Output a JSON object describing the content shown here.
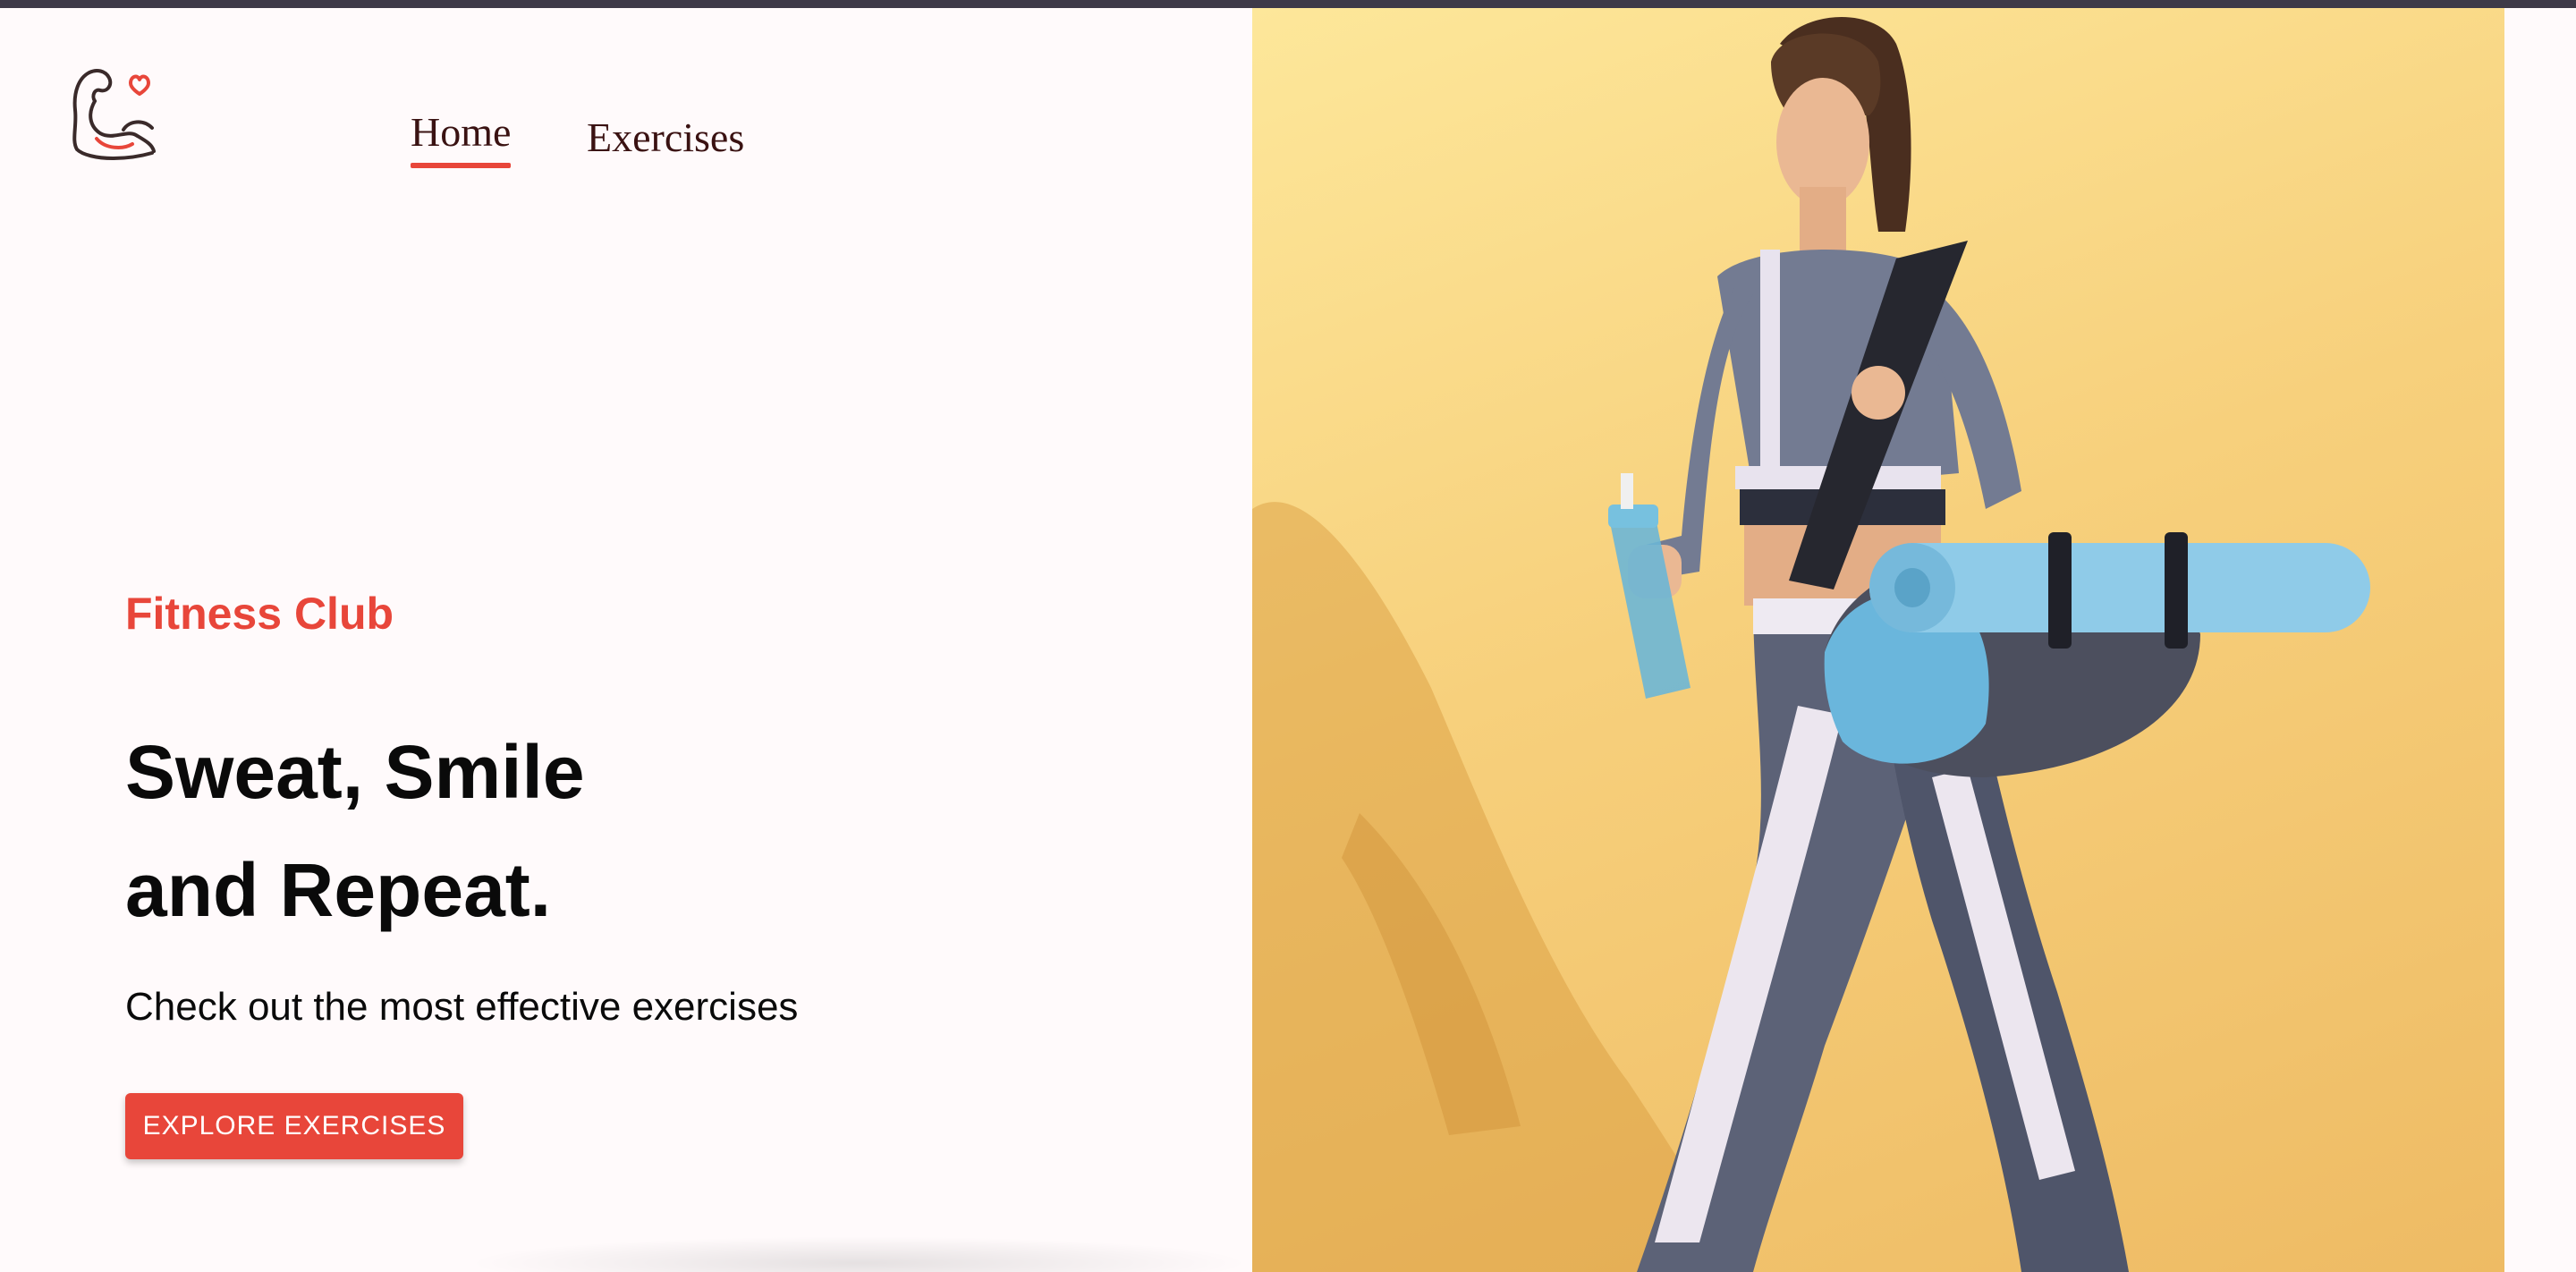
{
  "nav": {
    "logo_icon": "flexed-arm-heart-icon",
    "links": [
      {
        "label": "Home",
        "active": true
      },
      {
        "label": "Exercises",
        "active": false
      }
    ]
  },
  "hero": {
    "brand": "Fitness Club",
    "headline_line1": "Sweat, Smile",
    "headline_line2": "and Repeat.",
    "subline": "Check out the most effective exercises",
    "cta_label": "EXPLORE EXERCISES"
  },
  "colors": {
    "accent": "#e8463a",
    "background": "#fffafb",
    "image_background": "#f7d07c"
  }
}
